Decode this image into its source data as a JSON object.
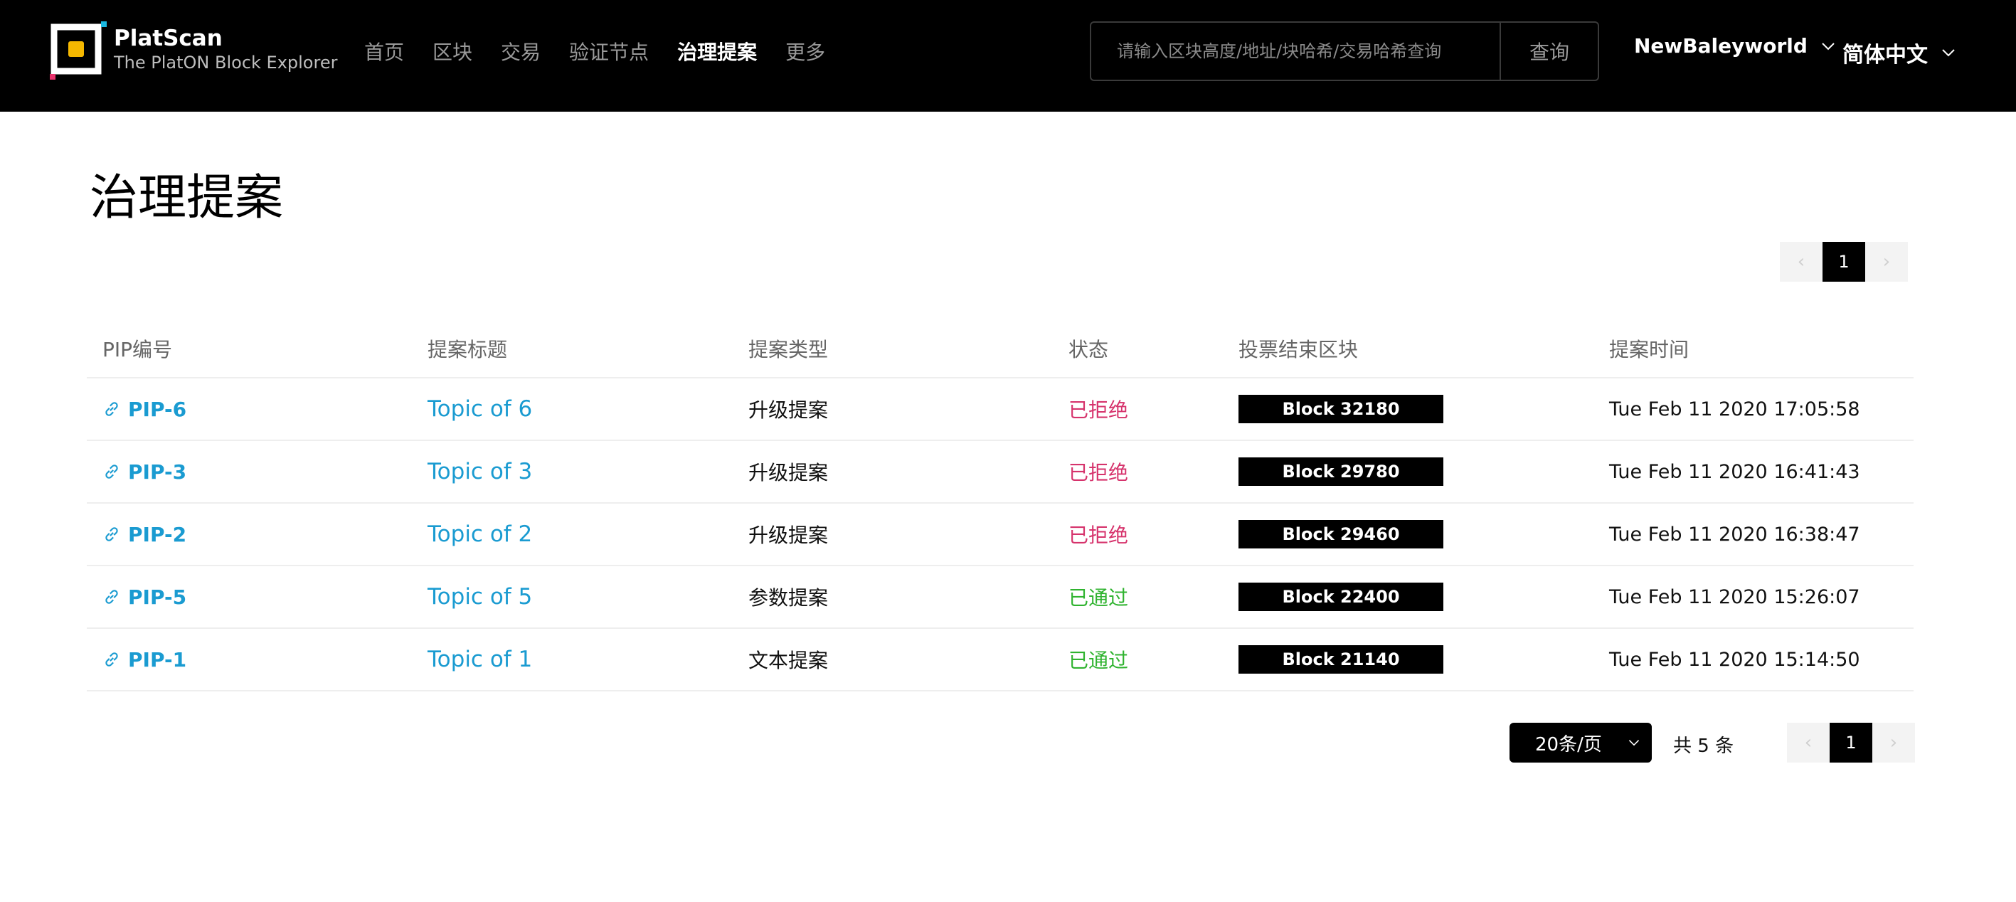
{
  "header": {
    "logo_title": "PlatScan",
    "logo_subtitle": "The PlatON Block Explorer",
    "nav": [
      {
        "label": "首页",
        "active": false
      },
      {
        "label": "区块",
        "active": false
      },
      {
        "label": "交易",
        "active": false
      },
      {
        "label": "验证节点",
        "active": false
      },
      {
        "label": "治理提案",
        "active": true
      },
      {
        "label": "更多",
        "active": false
      }
    ],
    "search_placeholder": "请输入区块高度/地址/块哈希/交易哈希查询",
    "search_button": "查询",
    "network": "NewBaleyworld",
    "language": "简体中文"
  },
  "page_title": "治理提案",
  "pager_top": {
    "prev": "‹",
    "current": "1",
    "next": "›"
  },
  "table": {
    "columns": [
      "PIP编号",
      "提案标题",
      "提案类型",
      "状态",
      "投票结束区块",
      "提案时间"
    ],
    "rows": [
      {
        "pip": "PIP-6",
        "title": "Topic of 6",
        "type": "升级提案",
        "status": "已拒绝",
        "status_kind": "rejected",
        "block": "Block 32180",
        "time": "Tue Feb 11 2020 17:05:58"
      },
      {
        "pip": "PIP-3",
        "title": "Topic of 3",
        "type": "升级提案",
        "status": "已拒绝",
        "status_kind": "rejected",
        "block": "Block 29780",
        "time": "Tue Feb 11 2020 16:41:43"
      },
      {
        "pip": "PIP-2",
        "title": "Topic of 2",
        "type": "升级提案",
        "status": "已拒绝",
        "status_kind": "rejected",
        "block": "Block 29460",
        "time": "Tue Feb 11 2020 16:38:47"
      },
      {
        "pip": "PIP-5",
        "title": "Topic of 5",
        "type": "参数提案",
        "status": "已通过",
        "status_kind": "passed",
        "block": "Block 22400",
        "time": "Tue Feb 11 2020 15:26:07"
      },
      {
        "pip": "PIP-1",
        "title": "Topic of 1",
        "type": "文本提案",
        "status": "已通过",
        "status_kind": "passed",
        "block": "Block 21140",
        "time": "Tue Feb 11 2020 15:14:50"
      }
    ]
  },
  "pager_bottom": {
    "page_size": "20条/页",
    "total": "共 5 条",
    "prev": "‹",
    "current": "1",
    "next": "›"
  },
  "colors": {
    "header_bg": "#000000",
    "link": "#1a9bd1",
    "rejected": "#d6336c",
    "passed": "#2fb32f",
    "logo_yellow": "#f5b800",
    "logo_cyan": "#19b8e0",
    "logo_pink": "#e8336d"
  }
}
